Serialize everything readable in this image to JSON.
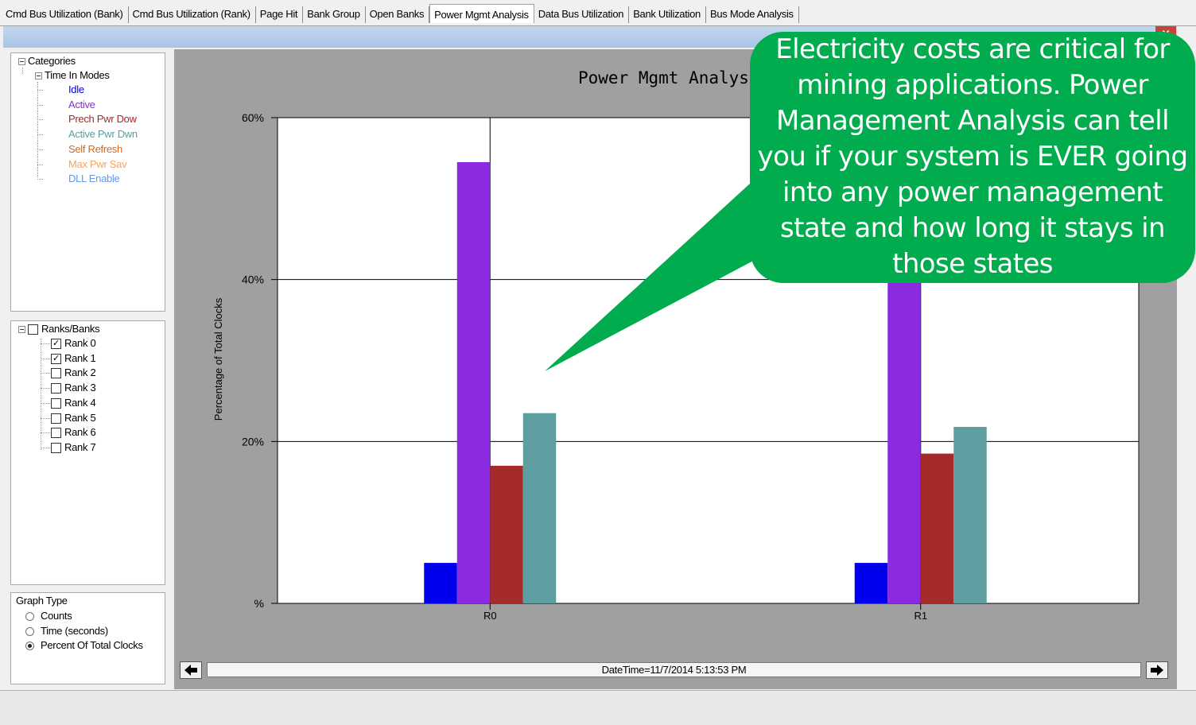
{
  "tabs": [
    {
      "label": "Cmd Bus Utilization (Bank)",
      "active": false
    },
    {
      "label": "Cmd Bus Utilization (Rank)",
      "active": false
    },
    {
      "label": "Page Hit",
      "active": false
    },
    {
      "label": "Bank Group",
      "active": false
    },
    {
      "label": "Open Banks",
      "active": false
    },
    {
      "label": "Power Mgmt Analysis",
      "active": true
    },
    {
      "label": "Data Bus Utilization",
      "active": false
    },
    {
      "label": "Bank Utilization",
      "active": false
    },
    {
      "label": "Bus Mode Analysis",
      "active": false
    }
  ],
  "categories": {
    "root_label": "Categories",
    "group_label": "Time In Modes",
    "items": [
      {
        "label": "Idle",
        "color": "#0000ee"
      },
      {
        "label": "Active",
        "color": "#8a2be2"
      },
      {
        "label": "Prech Pwr Dow",
        "color": "#a52a2a"
      },
      {
        "label": "Active Pwr Dwn",
        "color": "#5f9ea0"
      },
      {
        "label": "Self Refresh",
        "color": "#d2691e"
      },
      {
        "label": "Max Pwr Sav",
        "color": "#f4a460"
      },
      {
        "label": "DLL Enable",
        "color": "#6495ed"
      }
    ]
  },
  "ranks": {
    "root_label": "Ranks/Banks",
    "items": [
      {
        "label": "Rank 0",
        "checked": true
      },
      {
        "label": "Rank 1",
        "checked": true
      },
      {
        "label": "Rank 2",
        "checked": false
      },
      {
        "label": "Rank 3",
        "checked": false
      },
      {
        "label": "Rank 4",
        "checked": false
      },
      {
        "label": "Rank 5",
        "checked": false
      },
      {
        "label": "Rank 6",
        "checked": false
      },
      {
        "label": "Rank 7",
        "checked": false
      }
    ]
  },
  "graph_type": {
    "label": "Graph Type",
    "options": [
      {
        "label": "Counts",
        "selected": false
      },
      {
        "label": "Time (seconds)",
        "selected": false
      },
      {
        "label": "Percent Of Total Clocks",
        "selected": true
      }
    ]
  },
  "close_label": "X",
  "nav": {
    "prev_icon": "left-arrow-icon",
    "next_icon": "right-arrow-icon",
    "datetime": "DateTime=11/7/2014 5:13:53 PM"
  },
  "callout": {
    "text": "Electricity costs are critical for mining applications.  Power Management Analysis can tell you if your system is EVER going into any power management state and how long it stays in those states",
    "color": "#00ac4e"
  },
  "chart_data": {
    "type": "bar",
    "title": "Power Mgmt Analysis",
    "ylabel": "Percentage of Total Clocks",
    "xlabel": "",
    "categories": [
      "R0",
      "R1"
    ],
    "ytick_labels": [
      "%",
      "20%",
      "40%",
      "60%"
    ],
    "ylim": [
      0,
      60
    ],
    "grid": true,
    "series": [
      {
        "name": "Idle",
        "color": "#0000ee",
        "values": [
          5,
          5
        ]
      },
      {
        "name": "Active",
        "color": "#8a2be2",
        "values": [
          54.5,
          42
        ]
      },
      {
        "name": "Prech Pwr Dow",
        "color": "#a52a2a",
        "values": [
          17,
          18.5
        ]
      },
      {
        "name": "Active Pwr Dwn",
        "color": "#5f9ea0",
        "values": [
          23.5,
          21.8
        ]
      }
    ]
  }
}
